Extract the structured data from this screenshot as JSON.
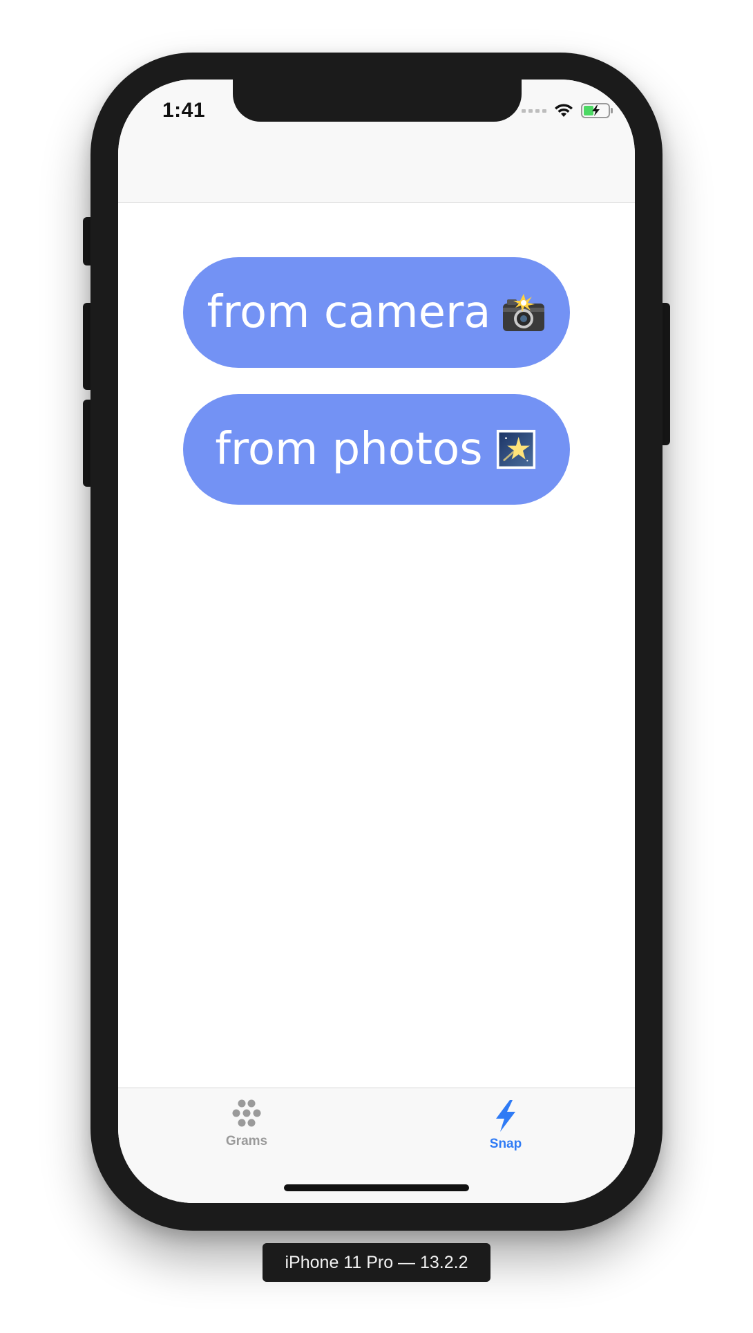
{
  "status_bar": {
    "time": "1:41"
  },
  "main": {
    "camera_button": {
      "label": "from camera",
      "icon": "camera-flash-icon"
    },
    "photos_button": {
      "label": "from photos",
      "icon": "night-stars-photo-icon"
    },
    "button_color": "#7392f4"
  },
  "tab_bar": {
    "tabs": [
      {
        "label": "Grams",
        "icon": "grams-dots-icon",
        "selected": false
      },
      {
        "label": "Snap",
        "icon": "lightning-bolt-icon",
        "selected": true
      }
    ],
    "active_color": "#2f7bf5",
    "inactive_color": "#9a9a9a"
  },
  "device": {
    "label": "iPhone 11 Pro — 13.2.2"
  }
}
